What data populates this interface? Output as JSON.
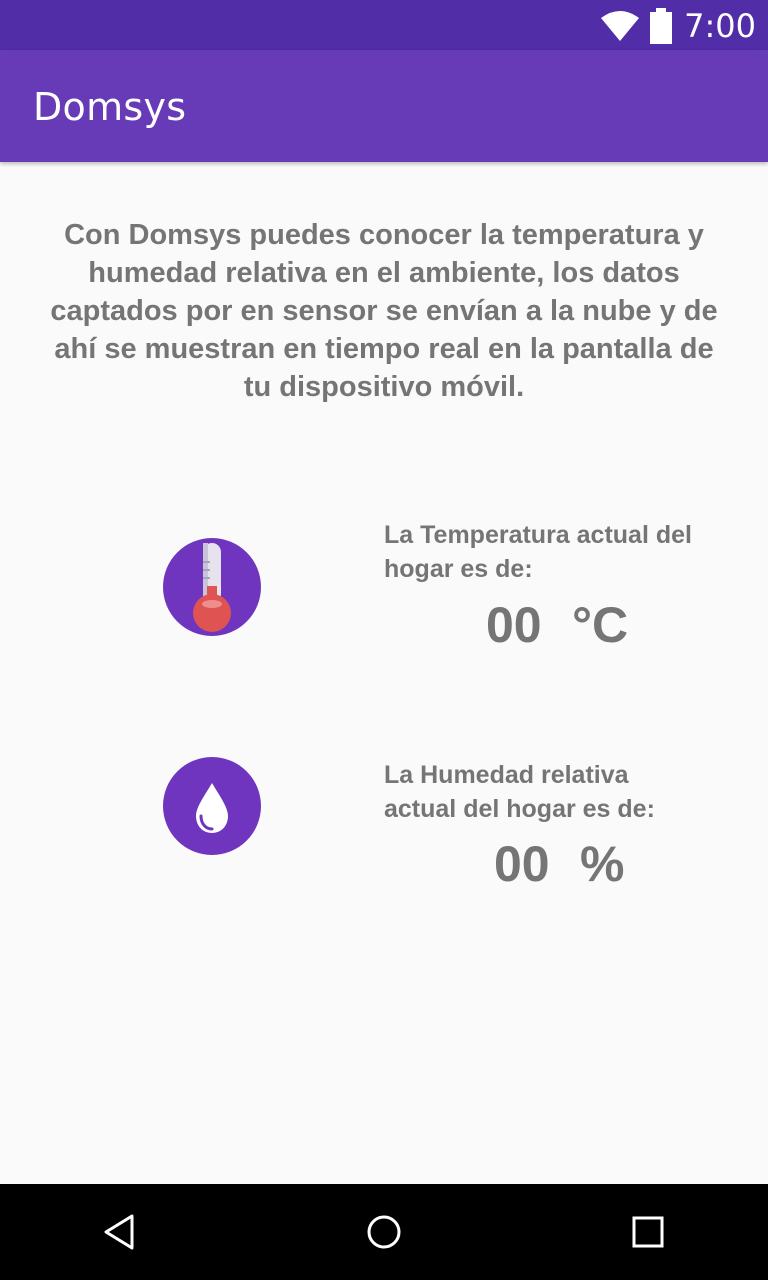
{
  "status_bar": {
    "time": "7:00",
    "icons": [
      "wifi-icon",
      "battery-icon"
    ]
  },
  "app_bar": {
    "title": "Domsys"
  },
  "intro": {
    "text": "Con Domsys puedes conocer la temperatura y humedad relativa en el ambiente, los datos captados por en sensor se envían a la nube y de ahí  se muestran en tiempo real en la pantalla de tu dispositivo móvil."
  },
  "temperature": {
    "icon": "thermometer-icon",
    "label": "La Temperatura actual del hogar es de:",
    "value": "00",
    "unit": "°C"
  },
  "humidity": {
    "icon": "water-drop-icon",
    "label": "La Humedad relativa actual del hogar es de:",
    "value": "00",
    "unit": "%"
  },
  "nav_bar": {
    "buttons": [
      "back-icon",
      "home-icon",
      "recents-icon"
    ]
  },
  "colors": {
    "status_bar": "#512da8",
    "app_bar": "#673ab7",
    "icon_circle": "#6f35bf",
    "text_gray": "#757575",
    "thermometer_bulb": "#e05353"
  }
}
